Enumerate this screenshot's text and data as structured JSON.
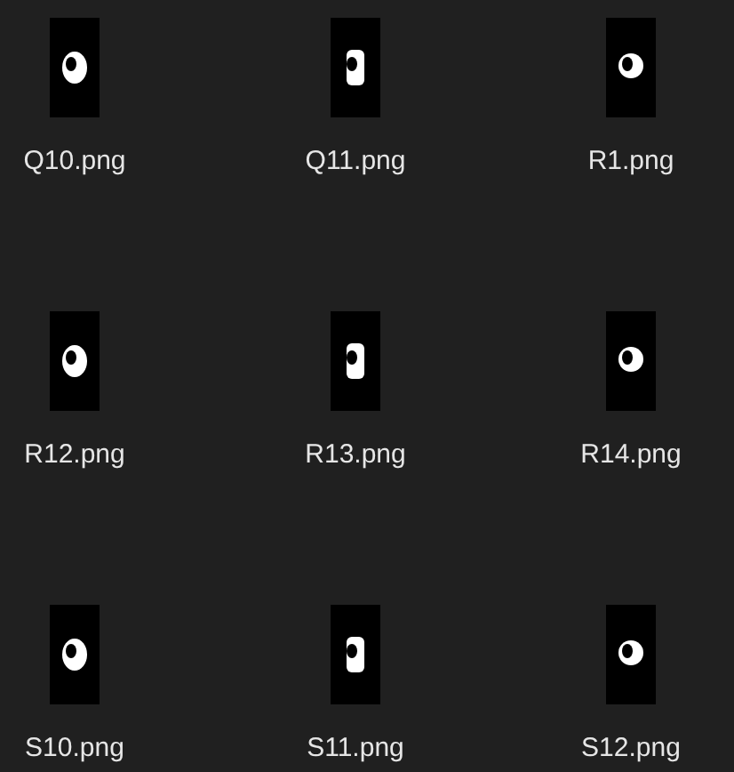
{
  "files": [
    {
      "name": "Q10.png"
    },
    {
      "name": "Q11.png"
    },
    {
      "name": "R1.png"
    },
    {
      "name": "R12.png"
    },
    {
      "name": "R13.png"
    },
    {
      "name": "R14.png"
    },
    {
      "name": "S10.png"
    },
    {
      "name": "S11.png"
    },
    {
      "name": "S12.png"
    }
  ]
}
